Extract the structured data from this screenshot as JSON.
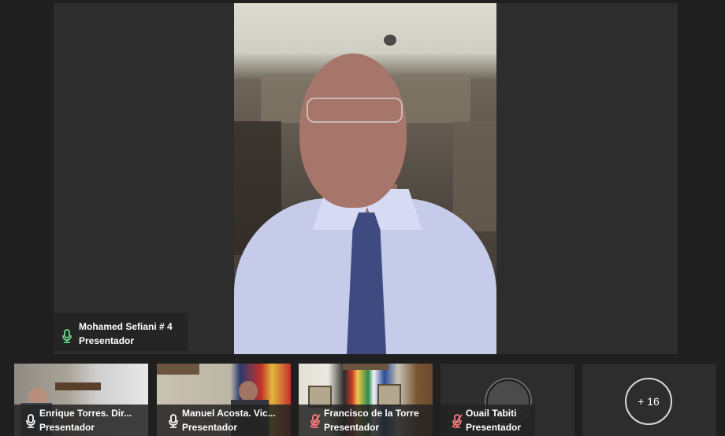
{
  "main_speaker": {
    "name": "Mohamed Sefiani # 4",
    "role": "Presentador",
    "mic": "mic-on"
  },
  "participants": [
    {
      "name": "Enrique Torres. Dir...",
      "role": "Presentador",
      "mic": "mic-on"
    },
    {
      "name": "Manuel Acosta. Vic...",
      "role": "Presentador",
      "mic": "mic-on"
    },
    {
      "name": "Francisco de la Torre",
      "role": "Presentador",
      "mic": "mic-muted"
    },
    {
      "name": "Ouail Tabiti",
      "role": "Presentador",
      "mic": "mic-muted"
    }
  ],
  "more_participants": {
    "label": "+ 16"
  },
  "colors": {
    "background": "#1f1f1f",
    "stage": "#2d2d2d",
    "mic_on": "#6fdc8c",
    "mic_muted": "#ff7b7b"
  }
}
